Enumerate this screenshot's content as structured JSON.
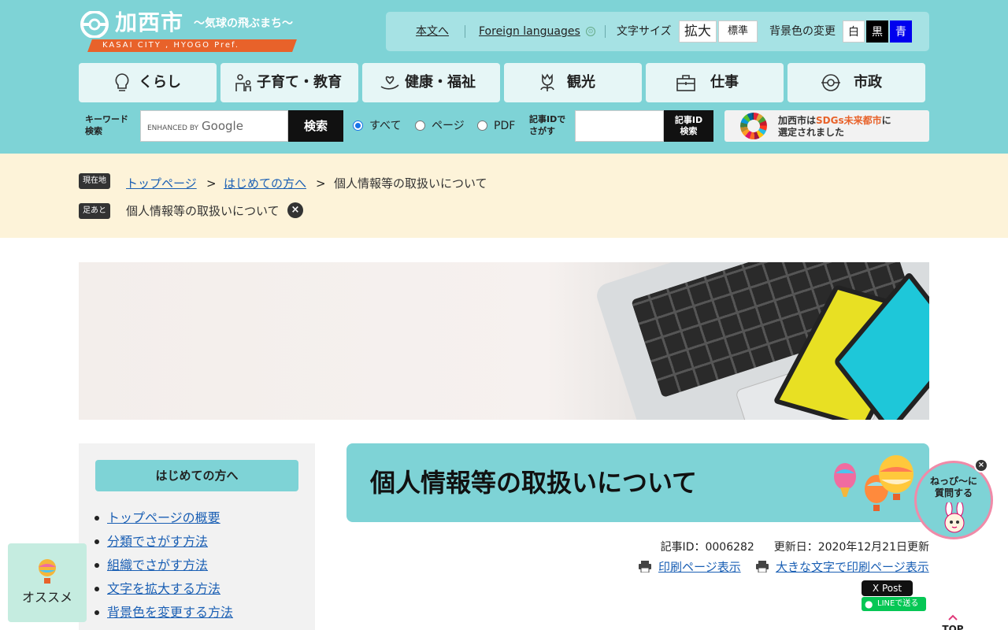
{
  "header": {
    "logo_name": "加西市",
    "logo_tagline": "〜気球の飛ぶまち〜",
    "logo_sub": "KASAI CITY , HYOGO Pref.",
    "util": {
      "body_link": "本文へ",
      "foreign_link": "Foreign languages",
      "font_size_label": "文字サイズ",
      "font_large": "拡大",
      "font_standard": "標準",
      "bg_label": "背景色の変更",
      "bg_white": "白",
      "bg_black": "黒",
      "bg_blue": "青"
    },
    "nav": [
      {
        "label": "くらし",
        "icon": "lightbulb-icon"
      },
      {
        "label": "子育て・教育",
        "icon": "parent-child-icon"
      },
      {
        "label": "健康・福祉",
        "icon": "heart-hand-icon"
      },
      {
        "label": "観光",
        "icon": "tulip-icon"
      },
      {
        "label": "仕事",
        "icon": "briefcase-icon"
      },
      {
        "label": "市政",
        "icon": "city-logo-icon"
      }
    ],
    "search": {
      "keyword_label_1": "キーワード",
      "keyword_label_2": "検索",
      "enhanced_by": "ENHANCED BY",
      "google": "Google",
      "button": "検索",
      "options": [
        "すべて",
        "ページ",
        "PDF"
      ],
      "selected": "すべて",
      "id_label": "記事IDでさがす",
      "id_button_1": "記事ID",
      "id_button_2": "検索"
    },
    "sdgs": {
      "line1_pre": "加西市は",
      "line1_hl": "SDGs未来都市",
      "line1_post": "に",
      "line2": "選定されました"
    }
  },
  "breadcrumb": {
    "current_tag": "現在地",
    "items": [
      "トップページ",
      "はじめての方へ",
      "個人情報等の取扱いについて"
    ],
    "separator": ">",
    "history_tag": "足あと",
    "history_item": "個人情報等の取扱いについて",
    "close": "×"
  },
  "side": {
    "heading": "はじめての方へ",
    "items": [
      "トップページの概要",
      "分類でさがす方法",
      "組織でさがす方法",
      "文字を拡大する方法",
      "背景色を変更する方法"
    ]
  },
  "main": {
    "title": "個人情報等の取扱いについて",
    "article_id": "記事ID：0006282",
    "updated": "更新日：2020年12月21日更新",
    "print_link": "印刷ページ表示",
    "print_large_link": "大きな文字で印刷ページ表示",
    "x_post": "X Post",
    "line_send": "LINEで送る"
  },
  "floating": {
    "osusume": "オススメ",
    "neppi_line1": "ねっぴ〜に",
    "neppi_line2": "質問する",
    "close": "×",
    "top": "TOP"
  },
  "colors": {
    "header_bg": "#7ed3d6",
    "breadcrumb_bg": "#fdf3d9",
    "accent_orange": "#e8622a",
    "link": "#1a5fb4"
  }
}
